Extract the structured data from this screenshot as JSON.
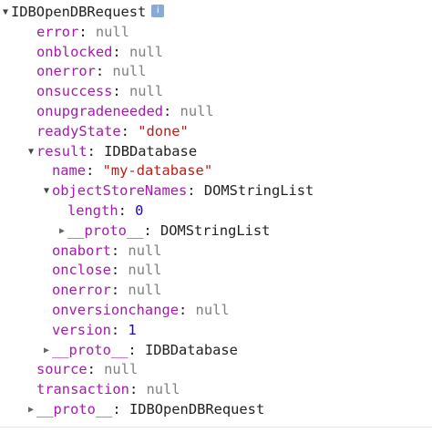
{
  "root": {
    "label": "IDBOpenDBRequest",
    "info_icon": "i"
  },
  "properties": [
    {
      "key": "error",
      "value": "null"
    },
    {
      "key": "onblocked",
      "value": "null"
    },
    {
      "key": "onerror",
      "value": "null"
    },
    {
      "key": "onsuccess",
      "value": "null"
    },
    {
      "key": "onupgradeneeded",
      "value": "null"
    },
    {
      "key": "readyState",
      "value": "\"done\""
    }
  ],
  "result": {
    "key": "result",
    "value": "IDBDatabase",
    "name": {
      "key": "name",
      "value": "\"my-database\""
    },
    "objectStoreNames": {
      "key": "objectStoreNames",
      "value": "DOMStringList",
      "length": {
        "key": "length",
        "value": "0"
      },
      "proto": {
        "key": "__proto__",
        "value": "DOMStringList"
      }
    },
    "handlers": [
      {
        "key": "onabort",
        "value": "null"
      },
      {
        "key": "onclose",
        "value": "null"
      },
      {
        "key": "onerror",
        "value": "null"
      },
      {
        "key": "onversionchange",
        "value": "null"
      }
    ],
    "version": {
      "key": "version",
      "value": "1"
    },
    "proto": {
      "key": "__proto__",
      "value": "IDBDatabase"
    }
  },
  "tail": [
    {
      "key": "source",
      "value": "null"
    },
    {
      "key": "transaction",
      "value": "null"
    }
  ],
  "root_proto": {
    "key": "__proto__",
    "value": "IDBOpenDBRequest"
  },
  "colors": {
    "property_key": "#a41bab",
    "null_value": "#808080",
    "string_value": "#c41a16",
    "number_value": "#1c00cf",
    "info_icon_bg": "#8aa9d6"
  },
  "icons": {
    "expanded": "triangle-down-icon",
    "collapsed": "triangle-right-icon"
  }
}
